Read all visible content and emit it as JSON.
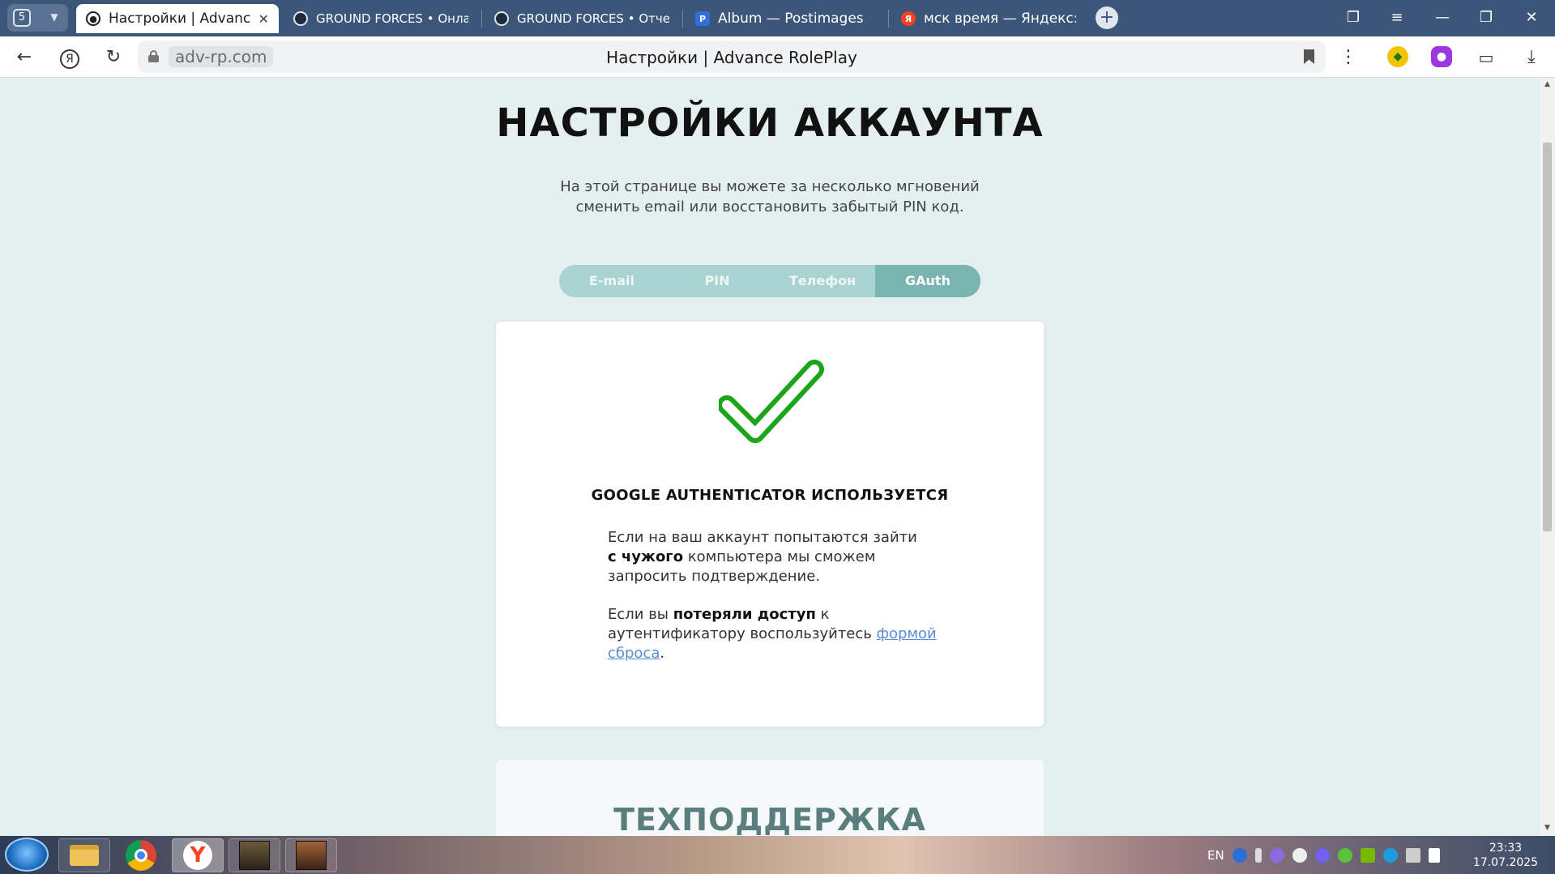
{
  "browser": {
    "tab_count": "5",
    "tabs": [
      {
        "title": "Настройки | Advance R",
        "active": true,
        "favicon": "advance-rp-logo"
      },
      {
        "title": "GROUND FORCES • Онлайн-пр",
        "active": false,
        "favicon": "advance-rp-logo"
      },
      {
        "title": "GROUND FORCES • Отчетная д",
        "active": false,
        "favicon": "advance-rp-logo"
      },
      {
        "title": "Album — Postimages",
        "active": false,
        "favicon": "postimages-logo"
      },
      {
        "title": "мск время — Яндекс: наш",
        "active": false,
        "favicon": "yandex-logo"
      }
    ],
    "url_domain": "adv-rp.com",
    "page_title": "Настройки | Advance RolePlay",
    "yandex_button": "Я"
  },
  "page": {
    "heading": "НАСТРОЙКИ АККАУНТА",
    "subtitle_line1": "На этой странице вы можете за несколько мгновений",
    "subtitle_line2": "сменить email или восстановить забытый PIN код.",
    "tabs": [
      "E-mail",
      "PIN",
      "Телефон",
      "GAuth"
    ],
    "active_tab": "GAuth",
    "card": {
      "status": "GOOGLE AUTHENTICATOR ИСПОЛЬЗУЕТСЯ",
      "p1_a": "Если на ваш аккаунт попытаются зайти",
      "p1_b": "с чужого",
      "p1_c": "компьютера мы сможем запросить подтверждение.",
      "p2_a": "Если вы",
      "p2_b": "потеряли доступ",
      "p2_c": "к аутентификатору воспользуйтесь",
      "p2_link": "формой сброса",
      "p2_end": "."
    },
    "support_title": "ТЕХПОДДЕРЖКА"
  },
  "taskbar": {
    "language": "EN",
    "time": "23:33",
    "date": "17.07.2025"
  },
  "colors": {
    "page_bg": "#e4f0ef",
    "tab_bg": "#a9d3d0",
    "tab_active": "#79b4b0",
    "check_green": "#1aa51a",
    "link": "#5b8ed1",
    "browser_frame": "#3c567a"
  }
}
